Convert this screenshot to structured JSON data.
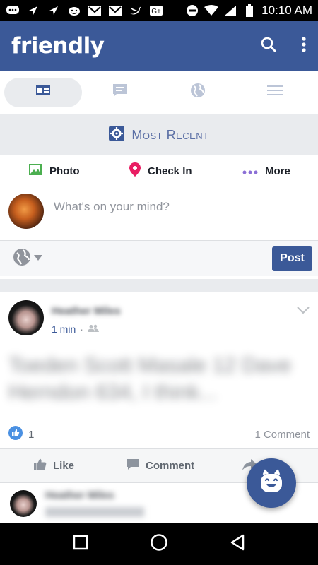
{
  "status_bar": {
    "time": "10:10 AM",
    "left_icons": [
      "chat-icon",
      "navigation-icon",
      "navigation-icon",
      "android-face-icon",
      "gmail-icon",
      "gmail-icon",
      "twitter-icon",
      "google-plus-icon"
    ],
    "right_icons": [
      "do-not-disturb-icon",
      "wifi-icon",
      "signal-icon",
      "battery-icon"
    ]
  },
  "app_bar": {
    "title": "friendly",
    "color": "#3b5998"
  },
  "tabs": [
    {
      "icon": "news-feed-icon",
      "active": true
    },
    {
      "icon": "messages-icon",
      "active": false
    },
    {
      "icon": "globe-icon",
      "active": false
    },
    {
      "icon": "menu-icon",
      "active": false
    }
  ],
  "feed_filter": {
    "label": "Most Recent",
    "icon": "settings-gear-icon"
  },
  "composer": {
    "actions": {
      "photo": "Photo",
      "check_in": "Check In",
      "more": "More"
    },
    "placeholder": "What's on your mind?",
    "post_label": "Post"
  },
  "post": {
    "author": "Heather Miles",
    "time": "1 min",
    "separator": "·",
    "body": "Toeden Scott Masale 12 Dave Herndon 634, I think...",
    "like_count": "1",
    "comment_count": "1 Comment",
    "actions": {
      "like": "Like",
      "comment": "Comment"
    }
  },
  "next_post": {
    "author": "Heather Miles"
  }
}
